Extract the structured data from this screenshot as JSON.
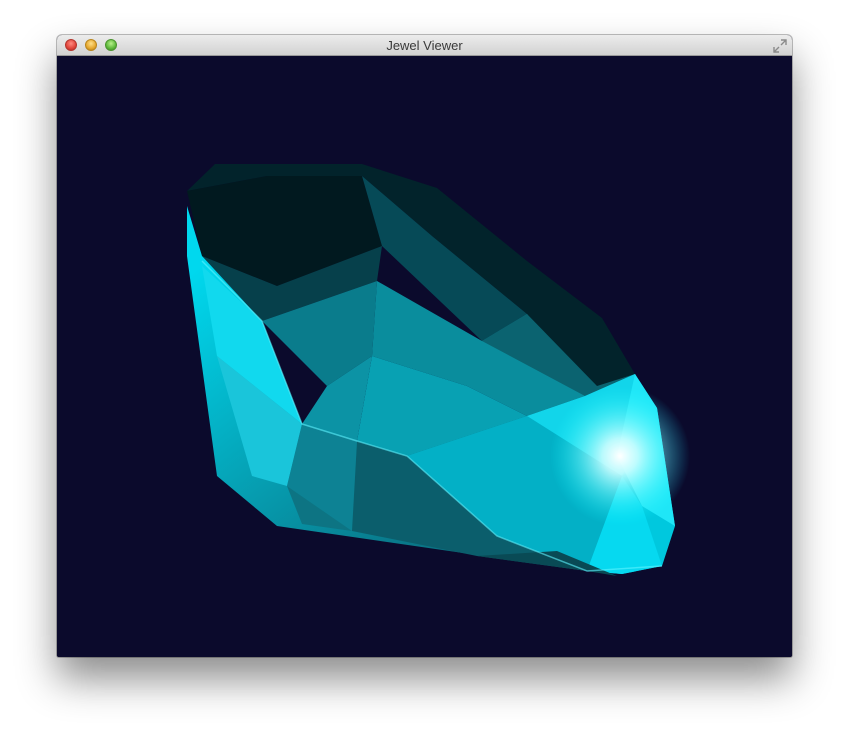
{
  "window": {
    "title": "Jewel Viewer",
    "controls": {
      "close": "close-icon",
      "minimize": "minimize-icon",
      "zoom": "zoom-icon",
      "fullscreen": "fullscreen-icon"
    }
  },
  "viewport": {
    "background_color": "#0b0a2c",
    "object": "gem",
    "gem_color": "#00c8e0"
  }
}
